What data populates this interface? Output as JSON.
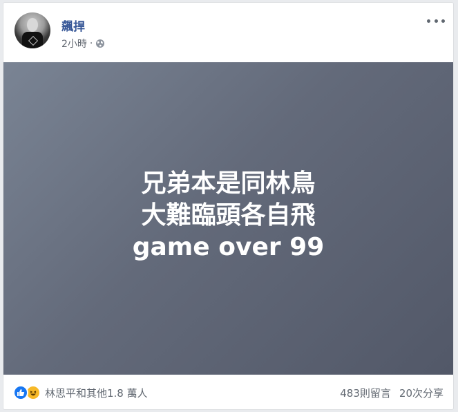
{
  "post": {
    "author": "飆捍",
    "time": "2小時",
    "dot": "·",
    "image_lines": [
      "兄弟本是同林鳥",
      "大難臨頭各自飛",
      "game over 99"
    ]
  },
  "footer": {
    "reactions_text": "林思平和其他1.8 萬人",
    "comments": "483則留言",
    "shares": "20次分享"
  },
  "icons": {
    "globe": "globe-icon",
    "more": "more-icon",
    "like": "like-icon",
    "haha": "haha-icon"
  },
  "colors": {
    "author": "#385898",
    "like": "#1877f2",
    "haha": "#f7b928"
  }
}
